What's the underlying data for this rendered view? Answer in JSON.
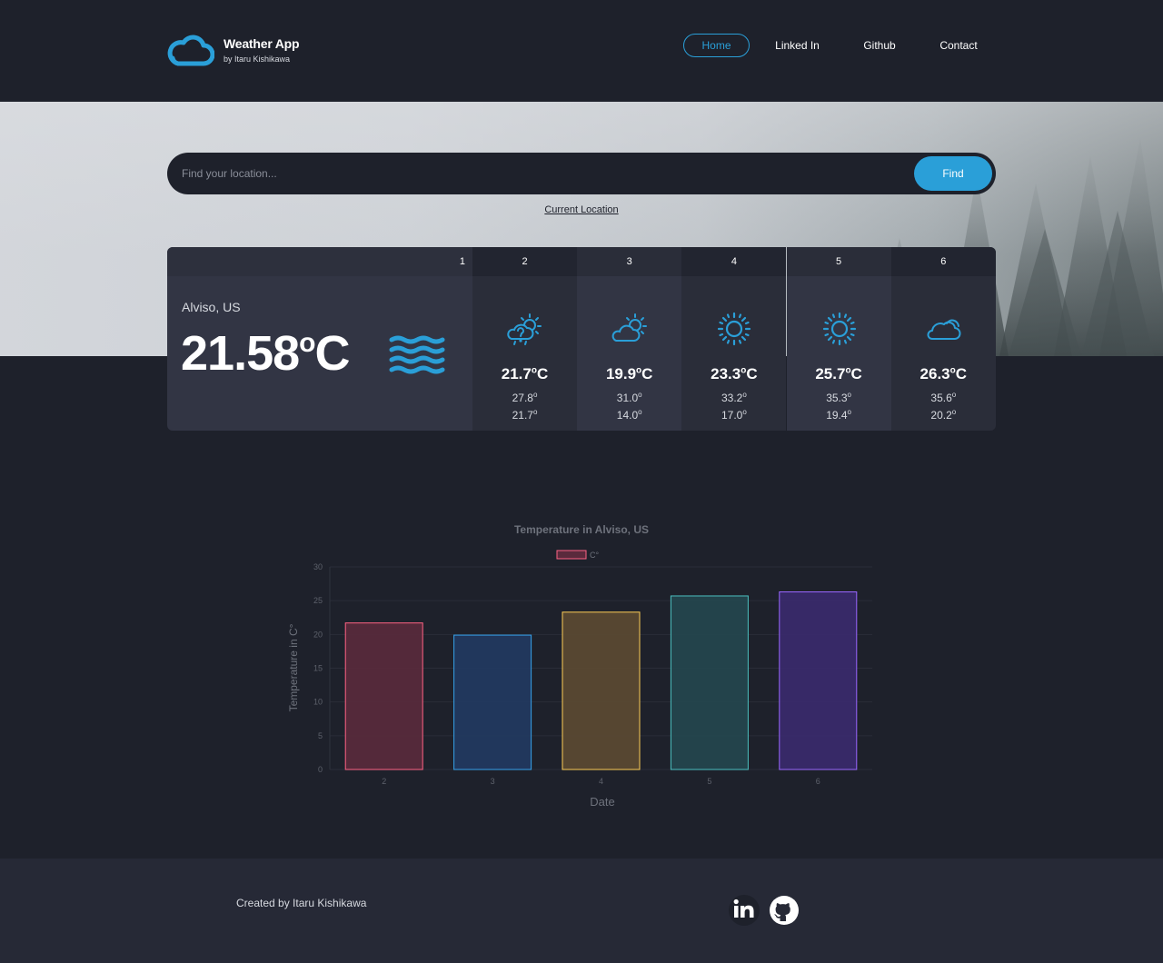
{
  "header": {
    "title": "Weather App",
    "subtitle": "by Itaru Kishikawa",
    "nav": [
      {
        "label": "Home",
        "active": true
      },
      {
        "label": "Linked In",
        "active": false
      },
      {
        "label": "Github",
        "active": false
      },
      {
        "label": "Contact",
        "active": false
      }
    ]
  },
  "search": {
    "placeholder": "Find your location...",
    "button_label": "Find",
    "current_location_link": "Current Location"
  },
  "today": {
    "day_number": "1",
    "location": "Alviso, US",
    "temperature": "21.58",
    "unit": "C",
    "degree": "o",
    "icon": "wind-waves-icon"
  },
  "forecast": [
    {
      "day": "2",
      "icon": "cloud-sun-question-icon",
      "temp": "21.7",
      "high": "27.8",
      "low": "21.7"
    },
    {
      "day": "3",
      "icon": "cloud-sun-icon",
      "temp": "19.9",
      "high": "31.0",
      "low": "14.0"
    },
    {
      "day": "4",
      "icon": "sun-icon",
      "temp": "23.3",
      "high": "33.2",
      "low": "17.0"
    },
    {
      "day": "5",
      "icon": "sun-icon",
      "temp": "25.7",
      "high": "35.3",
      "low": "19.4"
    },
    {
      "day": "6",
      "icon": "cloud-icon",
      "temp": "26.3",
      "high": "35.6",
      "low": "20.2"
    }
  ],
  "forecast_units": {
    "degree": "o",
    "unit": "C"
  },
  "chart_data": {
    "type": "bar",
    "title": "Temperature in Alviso, US",
    "legend": [
      "C°"
    ],
    "legend_position": "top",
    "categories": [
      "2",
      "3",
      "4",
      "5",
      "6"
    ],
    "series": [
      {
        "name": "C°",
        "values": [
          21.7,
          19.9,
          23.3,
          25.7,
          26.3
        ]
      }
    ],
    "xlabel": "Date",
    "ylabel": "Temperature in C°",
    "ylim": [
      0,
      30
    ],
    "yticks": [
      0,
      5,
      10,
      15,
      20,
      25,
      30
    ],
    "grid": true,
    "colors": {
      "fill": [
        "#5a2a3c",
        "#213a62",
        "#5c4a32",
        "#24474f",
        "#3a2a6e"
      ],
      "stroke": [
        "#ff6384",
        "#36a2eb",
        "#ffce56",
        "#4bc0c0",
        "#9966ff"
      ]
    }
  },
  "footer": {
    "credit": "Created by Itaru Kishikawa",
    "icons": [
      "linkedin-icon",
      "github-icon"
    ]
  },
  "colors": {
    "accent": "#2a9fd8",
    "background": "#1e212b",
    "card": "#323544",
    "card_alt": "#2d303d"
  }
}
